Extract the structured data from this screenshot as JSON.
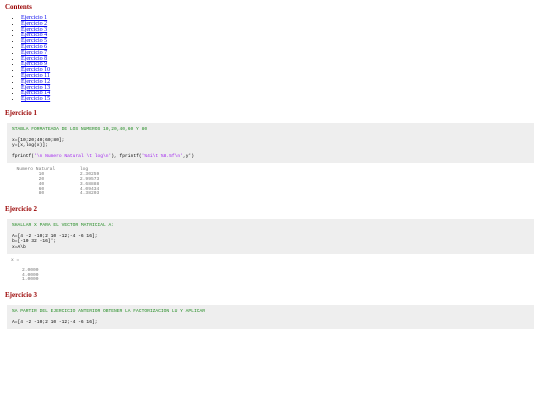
{
  "contents": {
    "heading": "Contents",
    "items": [
      "Ejercicio 1",
      "Ejercicio 2",
      "Ejercicio 3",
      "Ejercicio 4",
      "Ejercicio 5",
      "Ejercicio 6",
      "Ejercicio 7",
      "Ejercicio 8",
      "Ejercicio 9",
      "Ejercicio 10",
      "Ejercicio 11",
      "Ejercicio 12",
      "Ejercicio 13",
      "Ejercicio 14",
      "Ejercicio 15"
    ]
  },
  "ej1": {
    "title": "Ejercicio 1",
    "comment": "%TABLA FORMATEADA DE LOS NUMEROS 10,20,40,60 Y 80",
    "code1": "x=[10;20;40;60;80];",
    "code2": "y=[x,log(x)];",
    "code3_a": "fprintf(",
    "code3_b": "'\\n Numero Natural \\t log\\n'",
    "code3_c": "), fprintf(",
    "code3_d": "'%4i\\t %8.5f\\n'",
    "code3_e": ",y')",
    "output": "  Numero Natural         log\n          10             2.30259\n          20             2.99573\n          40             3.68888\n          60             4.09434\n          80             4.38203"
  },
  "ej2": {
    "title": "Ejercicio 2",
    "comment": "%HALLAR X PARA EL VECTOR MATRICIAL A:",
    "code1": "A=[4 -2 -10;2 10 -12;-4 -6 16];",
    "code2": "b=[-10 32 -16]';",
    "code3": "x=A\\b",
    "output": "x =\n\n    2.0000\n    4.0000\n    1.0000"
  },
  "ej3": {
    "title": "Ejercicio 3",
    "comment": "%A PARTIR DEL EJERCICIO ANTERIOR OBTENER LA FACTORIZACION LU Y APLICAR",
    "code1": "A=[4 -2 -10;2 10 -12;-4 -6 16];"
  }
}
